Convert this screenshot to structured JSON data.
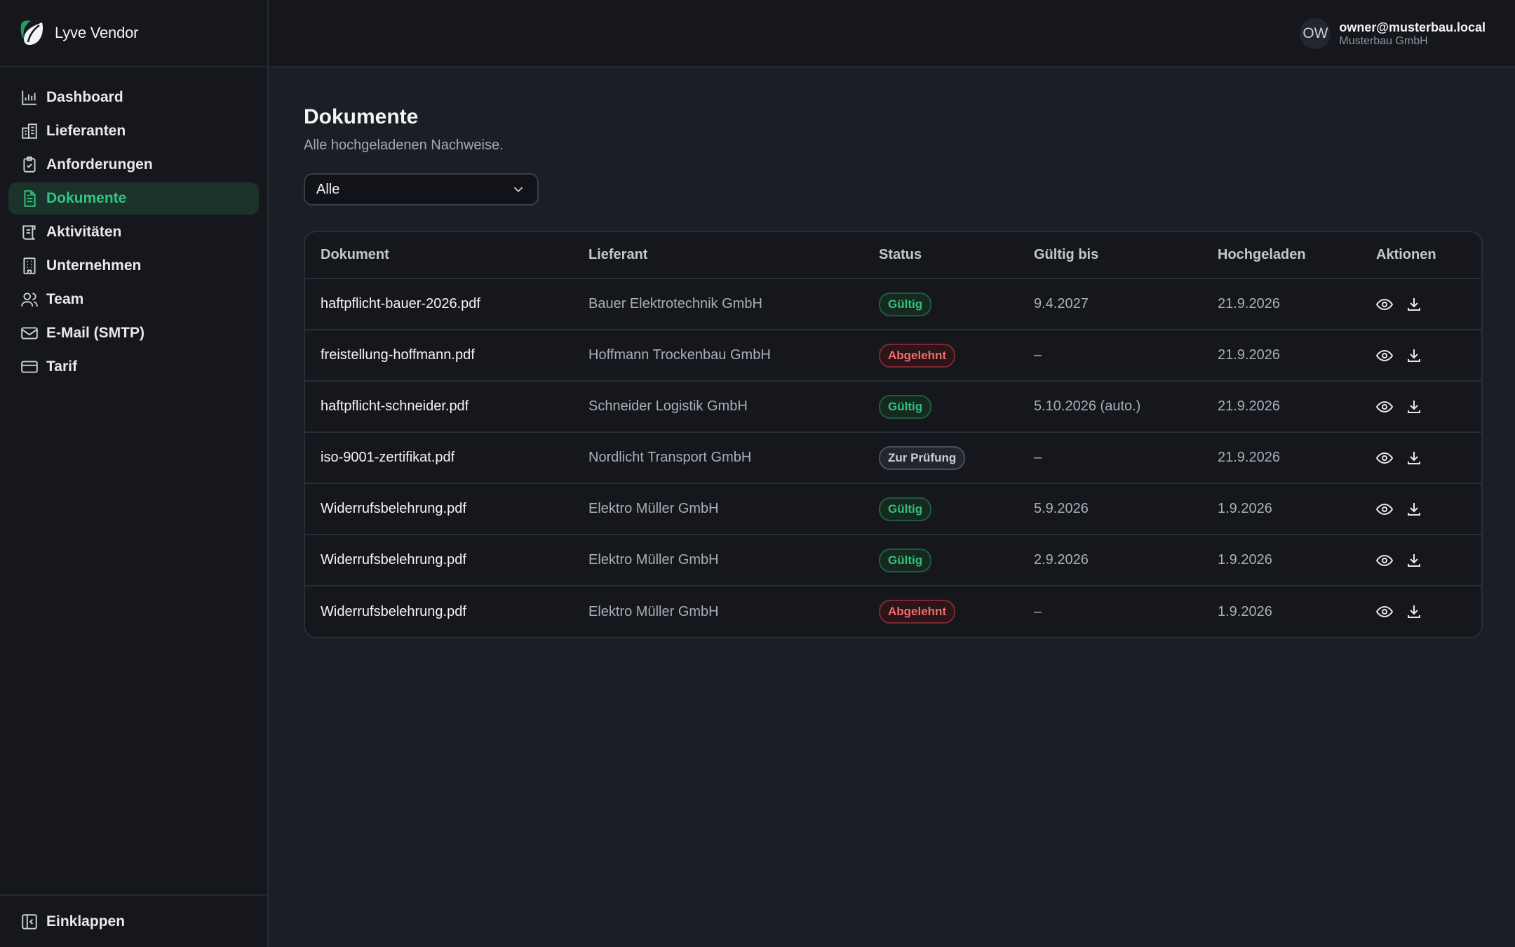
{
  "brand": {
    "name": "Lyve Vendor",
    "logo_icon": "leaf-logo-icon",
    "accent": "#2fc583"
  },
  "sidebar": {
    "items": [
      {
        "label": "Dashboard",
        "icon": "chart-bar-icon"
      },
      {
        "label": "Lieferanten",
        "icon": "building-icon"
      },
      {
        "label": "Anforderungen",
        "icon": "clipboard-check-icon"
      },
      {
        "label": "Dokumente",
        "icon": "file-text-icon",
        "active": true
      },
      {
        "label": "Aktivitäten",
        "icon": "scroll-icon"
      },
      {
        "label": "Unternehmen",
        "icon": "office-building-icon"
      },
      {
        "label": "Team",
        "icon": "users-icon"
      },
      {
        "label": "E-Mail (SMTP)",
        "icon": "mail-icon"
      },
      {
        "label": "Tarif",
        "icon": "credit-card-icon"
      }
    ],
    "collapse_label": "Einklappen"
  },
  "header": {
    "avatar_initials": "OW",
    "user_email": "owner@musterbau.local",
    "user_company": "Musterbau GmbH"
  },
  "main": {
    "title": "Dokumente",
    "subtitle": "Alle hochgeladenen Nachweise.",
    "filter": {
      "value": "Alle"
    },
    "table": {
      "columns": [
        "Dokument",
        "Lieferant",
        "Status",
        "Gültig bis",
        "Hochgeladen",
        "Aktionen"
      ],
      "rows": [
        {
          "document": "haftpflicht-bauer-2026.pdf",
          "supplier": "Bauer Elektrotechnik GmbH",
          "status": "Gültig",
          "status_type": "ok",
          "valid_until": "9.4.2027",
          "uploaded": "21.9.2026"
        },
        {
          "document": "freistellung-hoffmann.pdf",
          "supplier": "Hoffmann Trockenbau GmbH",
          "status": "Abgelehnt",
          "status_type": "rej",
          "valid_until": "–",
          "uploaded": "21.9.2026"
        },
        {
          "document": "haftpflicht-schneider.pdf",
          "supplier": "Schneider Logistik GmbH",
          "status": "Gültig",
          "status_type": "ok",
          "valid_until": "5.10.2026 (auto.)",
          "uploaded": "21.9.2026"
        },
        {
          "document": "iso-9001-zertifikat.pdf",
          "supplier": "Nordlicht Transport GmbH",
          "status": "Zur Prüfung",
          "status_type": "rev",
          "valid_until": "–",
          "uploaded": "21.9.2026"
        },
        {
          "document": "Widerrufsbelehrung.pdf",
          "supplier": "Elektro Müller GmbH",
          "status": "Gültig",
          "status_type": "ok",
          "valid_until": "5.9.2026",
          "uploaded": "1.9.2026"
        },
        {
          "document": "Widerrufsbelehrung.pdf",
          "supplier": "Elektro Müller GmbH",
          "status": "Gültig",
          "status_type": "ok",
          "valid_until": "2.9.2026",
          "uploaded": "1.9.2026"
        },
        {
          "document": "Widerrufsbelehrung.pdf",
          "supplier": "Elektro Müller GmbH",
          "status": "Abgelehnt",
          "status_type": "rej",
          "valid_until": "–",
          "uploaded": "1.9.2026"
        }
      ],
      "row_actions": [
        "eye-icon",
        "download-icon"
      ]
    }
  }
}
